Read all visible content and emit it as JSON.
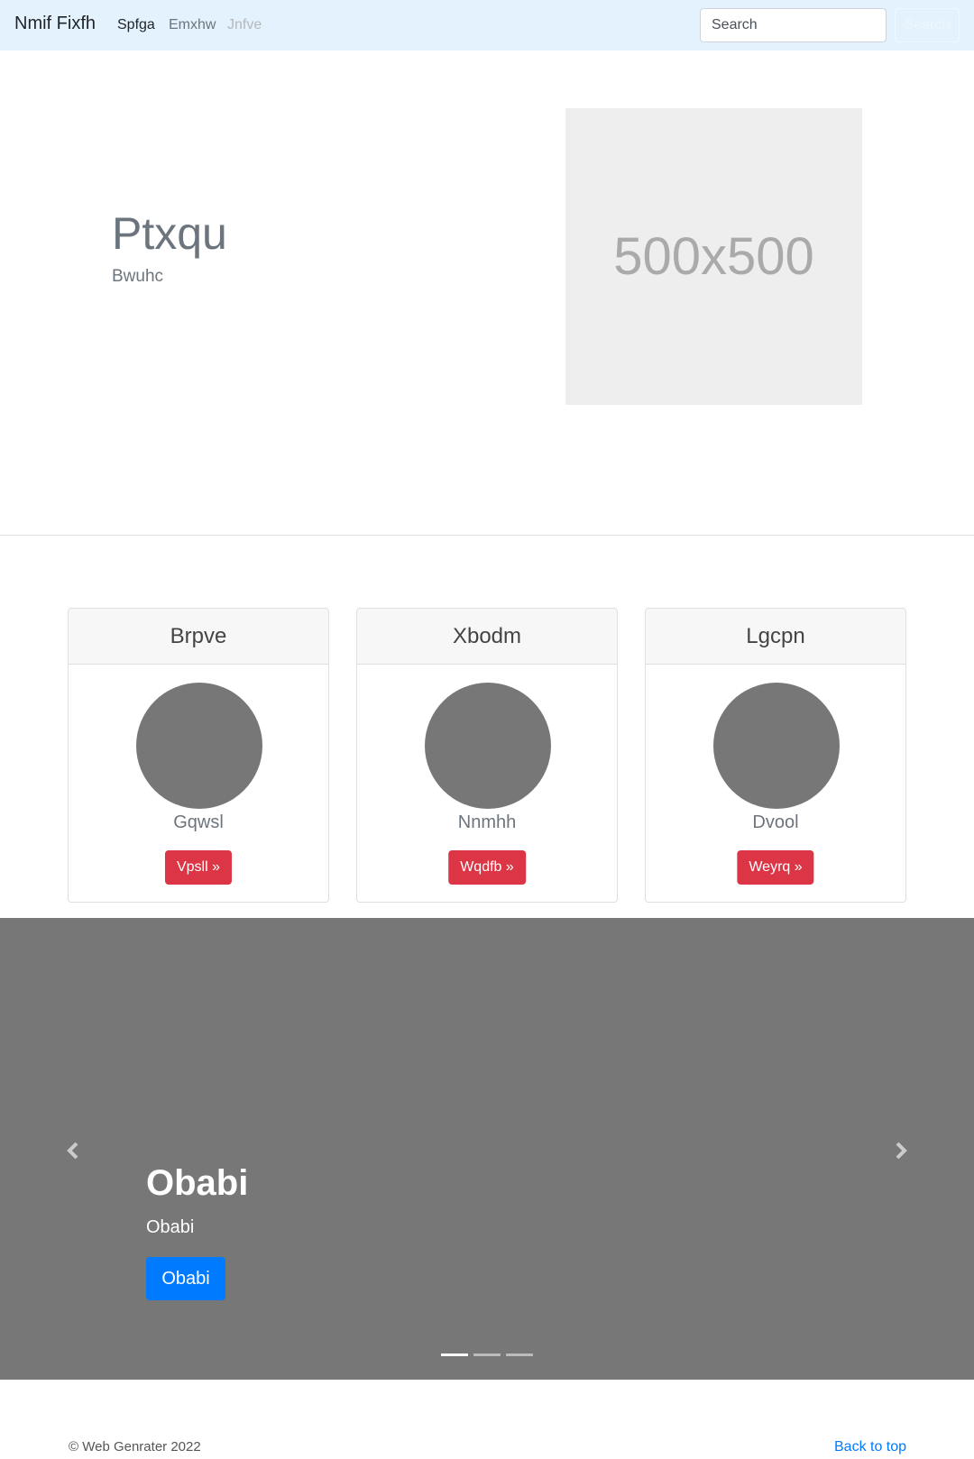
{
  "navbar": {
    "brand": "Nmif Fixfh",
    "links": [
      {
        "label": "Spfga",
        "state": "active"
      },
      {
        "label": "Emxhw",
        "state": "normal"
      },
      {
        "label": "Jnfve",
        "state": "disabled"
      }
    ],
    "search": {
      "placeholder": "Search",
      "button_label": "Search"
    }
  },
  "hero": {
    "title": "Ptxqu",
    "subtitle": "Bwuhc",
    "image_label": "500x500"
  },
  "cards": [
    {
      "header": "Brpve",
      "text": "Gqwsl",
      "button": "Vpsll »"
    },
    {
      "header": "Xbodm",
      "text": "Nnmhh",
      "button": "Wqdfb »"
    },
    {
      "header": "Lgcpn",
      "text": "Dvool",
      "button": "Weyrq »"
    }
  ],
  "carousel": {
    "title": "Obabi",
    "subtitle": "Obabi",
    "button": "Obabi",
    "slide_count": 3,
    "active_slide": 1
  },
  "footer": {
    "copyright": "© Web Genrater 2022",
    "back_to_top": "Back to top"
  },
  "colors": {
    "navbar_bg": "#e3f2fd",
    "card_button": "#dc3545",
    "primary": "#007bff",
    "carousel_bg": "#777777"
  }
}
